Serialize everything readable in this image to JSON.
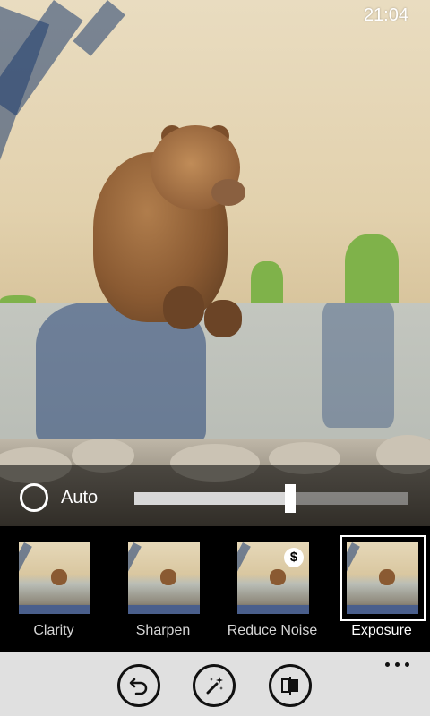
{
  "status_bar": {
    "time": "21:04"
  },
  "adjust": {
    "auto_label": "Auto",
    "slider_level": 0.57
  },
  "tools": [
    {
      "label": "Clarity",
      "selected": false,
      "premium": false
    },
    {
      "label": "Sharpen",
      "selected": false,
      "premium": false
    },
    {
      "label": "Reduce Noise",
      "selected": false,
      "premium": true,
      "badge": "$"
    },
    {
      "label": "Exposure",
      "selected": true,
      "premium": false
    }
  ],
  "app_bar": {
    "buttons": [
      {
        "icon": "undo-icon"
      },
      {
        "icon": "magic-wand-icon"
      },
      {
        "icon": "compare-icon"
      }
    ],
    "more_icon": "more-dots-icon"
  },
  "colors": {
    "app_bar_bg": "#e0e0e0",
    "selected_outline": "#ffffff"
  }
}
